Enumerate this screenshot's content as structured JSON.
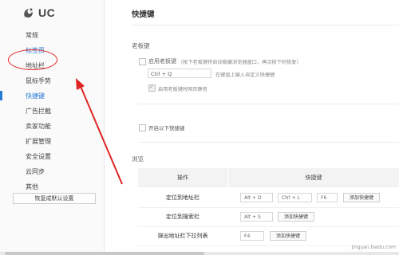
{
  "logo": {
    "text": "UC"
  },
  "sidebar": {
    "items": [
      {
        "label": "常规"
      },
      {
        "label": "标签页"
      },
      {
        "label": "地址栏"
      },
      {
        "label": "鼠标手势"
      },
      {
        "label": "快捷键"
      },
      {
        "label": "广告拦截"
      },
      {
        "label": "卖家功能"
      },
      {
        "label": "扩展管理"
      },
      {
        "label": "安全设置"
      },
      {
        "label": "云同步"
      },
      {
        "label": "其他"
      }
    ],
    "reset_label": "恢复成默认设置"
  },
  "main": {
    "title": "快捷键",
    "boss_key": {
      "section_title": "老板键",
      "enable_label": "启用老板键",
      "enable_hint": "（按下老板键将自动隐藏浏览器窗口，再次按下则恢复）",
      "key_value": "Ctrl + Q",
      "key_hint": "在键盘上输入自定义快捷键",
      "mute_label": "启用老板键时网页静音"
    },
    "enable_shortcuts_label": "开启以下快捷键",
    "browse": {
      "section_title": "浏览",
      "header_op": "操作",
      "header_key": "快捷键",
      "rows": [
        {
          "label": "定位到地址栏",
          "keys": [
            "Alt + D",
            "Ctrl + L",
            "F6"
          ],
          "add_label": "添加快捷键"
        },
        {
          "label": "定位到搜索栏",
          "keys": [
            "Alt + S"
          ],
          "add_label": "添加快捷键"
        },
        {
          "label": "弹出地址栏下拉列表",
          "keys": [
            "F4"
          ],
          "add_label": "添加快捷键"
        }
      ]
    }
  },
  "watermark": "jingyan.baidu.com",
  "colors": {
    "accent": "#2a7ad5",
    "annotation": "#e02424"
  }
}
